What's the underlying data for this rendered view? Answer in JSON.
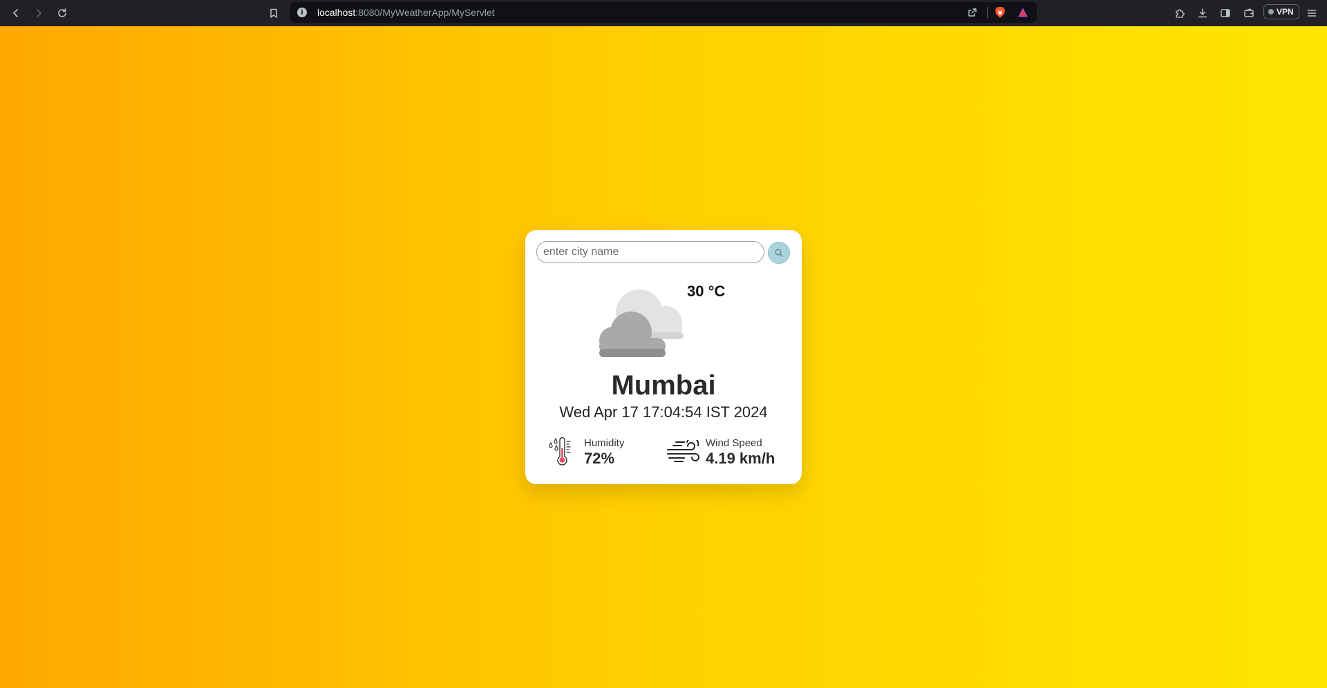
{
  "browser": {
    "url_host": "localhost",
    "url_rest": ":8080/MyWeatherApp/MyServlet",
    "vpn_label": "VPN"
  },
  "search": {
    "placeholder": "enter city name",
    "value": ""
  },
  "weather": {
    "temperature": "30 °C",
    "city": "Mumbai",
    "datetime": "Wed Apr 17 17:04:54 IST 2024",
    "humidity_label": "Humidity",
    "humidity_value": "72%",
    "wind_label": "Wind Speed",
    "wind_value": "4.19 km/h"
  },
  "icons": {
    "weather": "cloud-icon",
    "humidity": "thermometer-humidity-icon",
    "wind": "wind-icon",
    "search": "search-icon"
  },
  "colors": {
    "background_start": "#ffa800",
    "background_end": "#ffe600",
    "card": "#ffffff",
    "search_button": "#a9d4dc"
  }
}
